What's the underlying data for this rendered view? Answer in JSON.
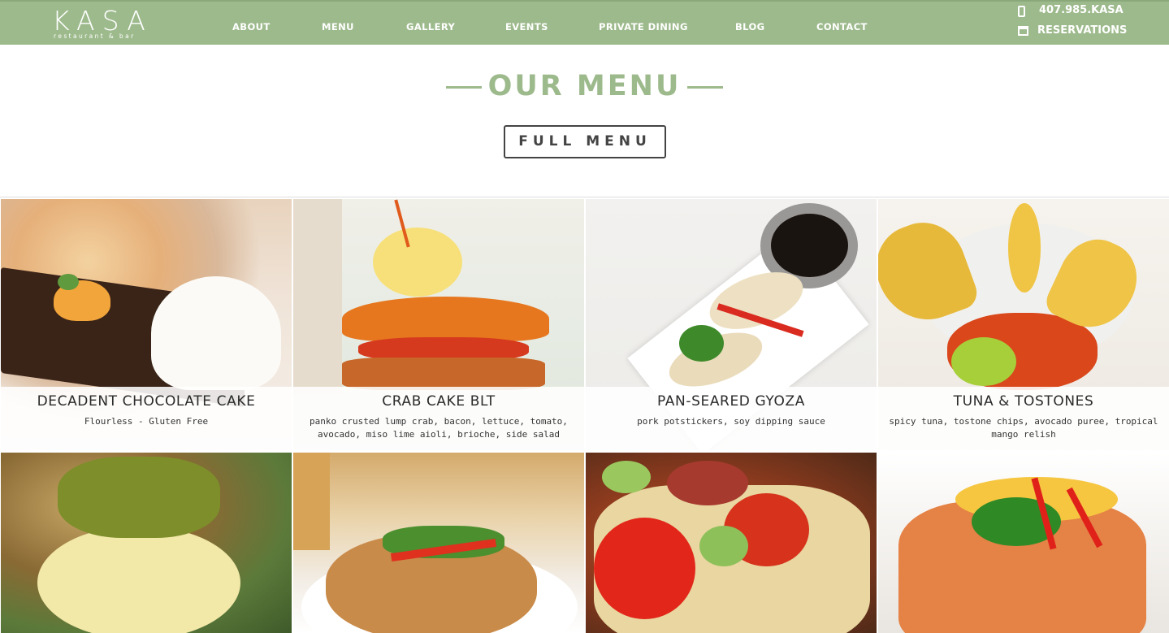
{
  "header": {
    "logo_text": "KASA",
    "logo_subtext": "restaurant & bar",
    "nav": [
      "ABOUT",
      "MENU",
      "GALLERY",
      "EVENTS",
      "PRIVATE DINING",
      "BLOG",
      "CONTACT"
    ],
    "phone": "407.985.KASA",
    "reservations": "RESERVATIONS",
    "icons": {
      "phone": "phone-icon",
      "reservations": "calendar-icon"
    }
  },
  "section": {
    "title": "OUR MENU",
    "button": "FULL MENU"
  },
  "menu_items": [
    {
      "title": "DECADENT CHOCOLATE CAKE",
      "description": "Flourless - Gluten Free"
    },
    {
      "title": "CRAB CAKE BLT",
      "description": "panko crusted lump crab, bacon, lettuce, tomato, avocado, miso lime aioli, brioche, side salad"
    },
    {
      "title": "PAN-SEARED GYOZA",
      "description": "pork potstickers, soy dipping sauce"
    },
    {
      "title": "TUNA & TOSTONES",
      "description": "spicy tuna, tostone chips, avocado puree, tropical mango relish"
    }
  ],
  "colors": {
    "brand_green": "#9dba8c",
    "text_dark": "#2a2a2a",
    "button_border": "#444444"
  }
}
